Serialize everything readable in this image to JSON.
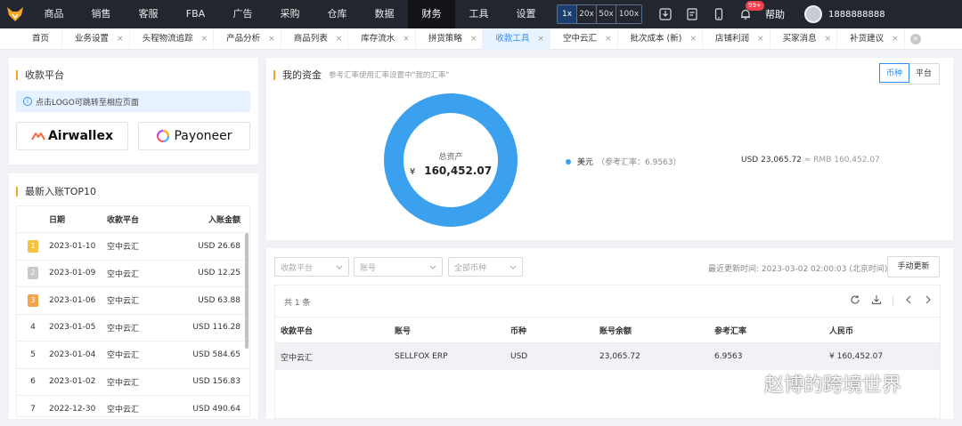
{
  "nav": {
    "items": [
      "商品",
      "销售",
      "客服",
      "FBA",
      "广告",
      "采购",
      "仓库",
      "数据",
      "财务",
      "工具",
      "设置"
    ],
    "active_index": 8,
    "zoom": [
      "1x",
      "20x",
      "50x",
      "100x"
    ],
    "notification_count": "99+",
    "help": "帮助",
    "phone": "1888888888"
  },
  "tabs": [
    "首页",
    "业务设置",
    "头程物流追踪",
    "产品分析",
    "商品列表",
    "库存流水",
    "拼货策略",
    "收款工具",
    "空中云汇",
    "批次成本 (新)",
    "店铺利润",
    "买家消息",
    "补货建议"
  ],
  "tabs_active_index": 7,
  "platform": {
    "title": "收款平台",
    "tip": "点击LOGO可跳转至相应页面",
    "logos": [
      "Airwallex",
      "Payoneer"
    ]
  },
  "top10": {
    "title": "最新入账TOP10",
    "headers": [
      "日期",
      "收款平台",
      "入账金额"
    ],
    "rows": [
      {
        "rank": "1",
        "date": "2023-01-10",
        "platform": "空中云汇",
        "amount": "USD 26.68"
      },
      {
        "rank": "2",
        "date": "2023-01-09",
        "platform": "空中云汇",
        "amount": "USD 12.25"
      },
      {
        "rank": "3",
        "date": "2023-01-06",
        "platform": "空中云汇",
        "amount": "USD 63.88"
      },
      {
        "rank": "4",
        "date": "2023-01-05",
        "platform": "空中云汇",
        "amount": "USD 116.28"
      },
      {
        "rank": "5",
        "date": "2023-01-04",
        "platform": "空中云汇",
        "amount": "USD 584.65"
      },
      {
        "rank": "6",
        "date": "2023-01-02",
        "platform": "空中云汇",
        "amount": "USD 156.83"
      },
      {
        "rank": "7",
        "date": "2022-12-30",
        "platform": "空中云汇",
        "amount": "USD 490.64"
      }
    ]
  },
  "funds": {
    "title": "我的资金",
    "subtitle": "参考汇率使用汇率设置中\"我的汇率\"",
    "toggle": [
      "币种",
      "平台"
    ],
    "total_label": "总资产",
    "currency_symbol": "¥",
    "total": "160,452.07",
    "legend_name": "美元",
    "legend_rate": "（参考汇率：6.9563）",
    "conversion_usd": "USD 23,065.72",
    "conversion_rmb": "≈ RMB 160,452.07",
    "ring_color": "#3ba0ee"
  },
  "accounts": {
    "filters": [
      "收款平台",
      "账号",
      "全部币种"
    ],
    "updated": "最近更新时间: 2023-03-02 02:00:03 (北京时间)",
    "refresh_button": "手动更新",
    "count": "共 1 条",
    "headers": [
      "收款平台",
      "账号",
      "币种",
      "账号余额",
      "参考汇率",
      "人民币"
    ],
    "rows": [
      [
        "空中云汇",
        "SELLFOX ERP",
        "USD",
        "23,065.72",
        "6.9563",
        "¥ 160,452.07"
      ]
    ]
  },
  "watermark": "赵博的跨境世界"
}
